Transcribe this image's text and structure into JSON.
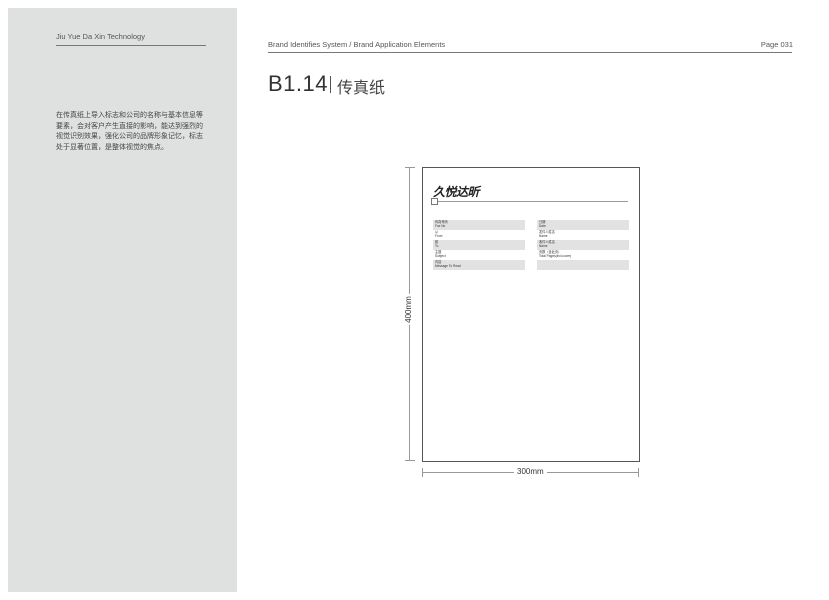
{
  "sidebar": {
    "company": "Jiu Yue Da Xin Technology",
    "description": "在传真纸上导入标志和公司的名称与基本信息等要素，会对客户产生直接的影响，能达到强烈的视觉识别效果，强化公司的品牌形象记忆，标志处于显著位置，是整体视觉的焦点。"
  },
  "header": {
    "system": "Brand Identifies System / Brand Application Elements",
    "page": "Page 031"
  },
  "section": {
    "code": "B1.14",
    "title": "传真纸"
  },
  "fax": {
    "logo": "久悦达昕",
    "fields_left": [
      {
        "cn": "传真号码",
        "en": "Fax No"
      },
      {
        "cn": "从",
        "en": "From"
      },
      {
        "cn": "致",
        "en": "To"
      },
      {
        "cn": "主题",
        "en": "Subject"
      },
      {
        "cn": "内容",
        "en": "Message To Read"
      }
    ],
    "fields_right": [
      {
        "cn": "日期",
        "en": "Date"
      },
      {
        "cn": "发件人姓名",
        "en": "Name"
      },
      {
        "cn": "收件人姓名",
        "en": "Name"
      },
      {
        "cn": "页数（含此页）",
        "en": "Total Pages(incl.cover)"
      }
    ]
  },
  "dimensions": {
    "height": "400mm",
    "width": "300mm"
  }
}
